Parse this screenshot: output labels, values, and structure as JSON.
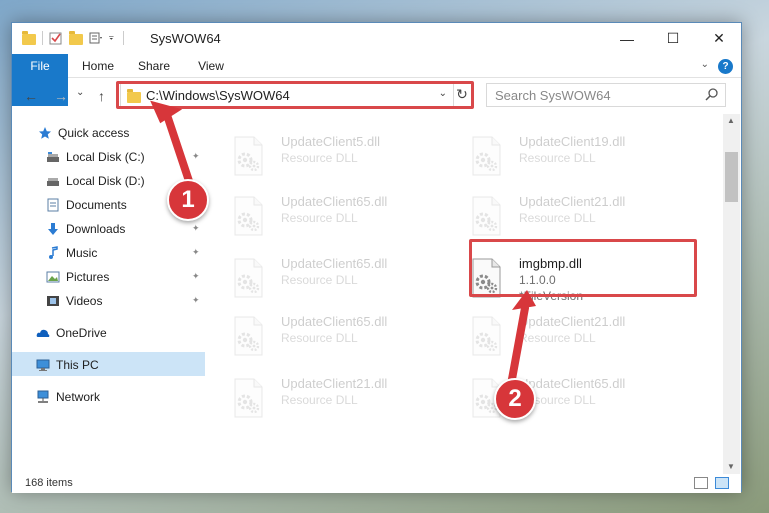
{
  "window": {
    "title": "SysWOW64",
    "minimize_glyph": "—",
    "maximize_glyph": "☐",
    "close_glyph": "✕"
  },
  "ribbon": {
    "tabs": [
      {
        "label": "File",
        "active": true
      },
      {
        "label": "Home"
      },
      {
        "label": "Share"
      },
      {
        "label": "View"
      }
    ],
    "help_glyph": "?"
  },
  "nav": {
    "back_glyph": "←",
    "forward_glyph": "→",
    "recent_glyph": "⌄",
    "up_glyph": "↑",
    "address": "C:\\Windows\\SysWOW64",
    "address_dropdown_glyph": "⌄",
    "refresh_glyph": "↻",
    "search_placeholder": "Search SysWOW64"
  },
  "sidebar": {
    "quick_access": "Quick access",
    "items": [
      {
        "label": "Local Disk (C:)",
        "icon": "drive-icon",
        "pinned": true
      },
      {
        "label": "Local Disk (D:)",
        "icon": "drive-icon",
        "pinned": false
      },
      {
        "label": "Documents",
        "icon": "documents-icon",
        "pinned": true
      },
      {
        "label": "Downloads",
        "icon": "downloads-icon",
        "pinned": true
      },
      {
        "label": "Music",
        "icon": "music-icon",
        "pinned": true
      },
      {
        "label": "Pictures",
        "icon": "pictures-icon",
        "pinned": true
      },
      {
        "label": "Videos",
        "icon": "videos-icon",
        "pinned": true
      }
    ],
    "onedrive": "OneDrive",
    "this_pc": "This PC",
    "network": "Network",
    "pin_glyph": "📌"
  },
  "files": [
    {
      "name": "UpdateClient5.dll",
      "desc": "Resource DLL",
      "faded": true
    },
    {
      "name": "UpdateClient19.dll",
      "desc": "Resource DLL",
      "faded": true
    },
    {
      "name": "UpdateClient65.dll",
      "desc": "Resource DLL",
      "faded": true
    },
    {
      "name": "UpdateClient21.dll",
      "desc": "Resource DLL",
      "faded": true
    },
    {
      "name": "UpdateClient65.dll",
      "desc": "Resource DLL",
      "faded": true
    },
    {
      "name": "imgbmp.dll",
      "desc": "1.1.0.0",
      "desc2": "*FileVersion",
      "faded": false
    },
    {
      "name": "UpdateClient65.dll",
      "desc": "Resource DLL",
      "faded": true
    },
    {
      "name": "UpdateClient21.dll",
      "desc": "Resource DLL",
      "faded": true
    },
    {
      "name": "UpdateClient21.dll",
      "desc": "Resource DLL",
      "faded": true
    },
    {
      "name": "UpdateClient65.dll",
      "desc": "Resource DLL",
      "faded": true
    }
  ],
  "status": {
    "items_count": "168 items"
  },
  "annotations": {
    "step1": "1",
    "step2": "2"
  },
  "colors": {
    "accent": "#1979ca",
    "highlight": "#d9484a",
    "selection": "#cce4f7"
  }
}
